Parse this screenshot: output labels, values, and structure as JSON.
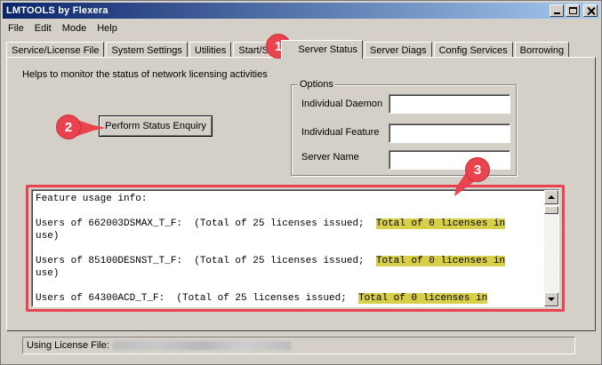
{
  "window": {
    "title": "LMTOOLS by Flexera"
  },
  "menu": [
    "File",
    "Edit",
    "Mode",
    "Help"
  ],
  "tabs": [
    "Service/License File",
    "System Settings",
    "Utilities",
    "Start/St",
    "Server Status",
    "Server Diags",
    "Config Services",
    "Borrowing"
  ],
  "active_tab": "Server Status",
  "help_text": "Helps to monitor the status of network licensing activities",
  "options": {
    "legend": "Options",
    "individual_daemon": {
      "label": "Individual Daemon",
      "value": ""
    },
    "individual_feature": {
      "label": "Individual Feature",
      "value": ""
    },
    "server_name": {
      "label": "Server Name",
      "value": ""
    }
  },
  "perform_button": "Perform Status Enquiry",
  "output": {
    "title": "Feature usage info:",
    "entries": [
      {
        "line": "Users of 662003DSMAX_T_F:  (Total of 25 licenses issued;",
        "highlight": "Total of 0 licenses in",
        "cont": "use)"
      },
      {
        "line": "Users of 85100DESNST_T_F:  (Total of 25 licenses issued;",
        "highlight": "Total of 0 licenses in",
        "cont": "use)"
      },
      {
        "line": "Users of 64300ACD_T_F:  (Total of 25 licenses issued;",
        "highlight": "Total of 0 licenses in",
        "cont": ""
      }
    ]
  },
  "status": {
    "label": "Using License File:"
  },
  "callouts": [
    "1",
    "2",
    "3"
  ],
  "colors": {
    "callout": "#e8434e",
    "highlight": "#d7cf4a",
    "titlebar": "#0a246a"
  }
}
